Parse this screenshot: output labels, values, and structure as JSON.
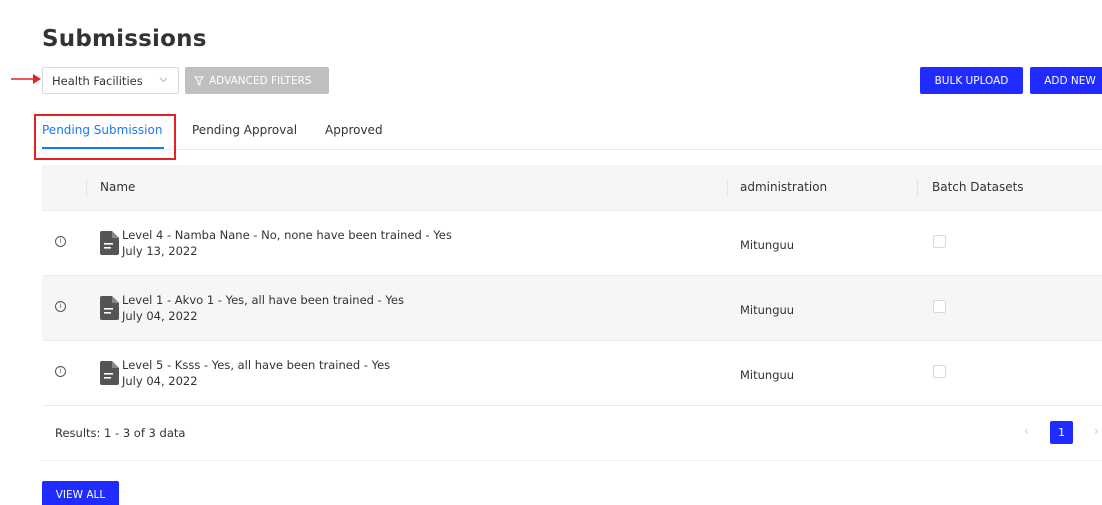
{
  "page": {
    "title": "Submissions"
  },
  "toolbar": {
    "form_select": {
      "value": "Health Facilities"
    },
    "advanced_filters_label": "ADVANCED FILTERS",
    "bulk_upload_label": "BULK UPLOAD",
    "add_new_label": "ADD NEW"
  },
  "tabs": [
    {
      "label": "Pending Submission",
      "active": true
    },
    {
      "label": "Pending Approval",
      "active": false
    },
    {
      "label": "Approved",
      "active": false
    }
  ],
  "table": {
    "columns": [
      "Name",
      "administration",
      "Batch Datasets"
    ],
    "rows": [
      {
        "name": "Level 4 - Namba Nane - No, none have been trained - Yes",
        "date": "July 13, 2022",
        "administration": "Mitunguu",
        "batch_checked": false
      },
      {
        "name": "Level 1 - Akvo 1 - Yes, all have been trained - Yes",
        "date": "July 04, 2022",
        "administration": "Mitunguu",
        "batch_checked": false
      },
      {
        "name": "Level 5 - Ksss - Yes, all have been trained - Yes",
        "date": "July 04, 2022",
        "administration": "Mitunguu",
        "batch_checked": false
      }
    ],
    "results_text": "Results: 1 - 3 of 3 data",
    "pagination": {
      "current_page": "1",
      "prev_icon": "chevron-left-icon",
      "next_icon": "chevron-right-icon"
    }
  },
  "view_all_label": "VIEW ALL",
  "colors": {
    "primary": "#1f2bff",
    "tab_active": "#1677ff",
    "highlight": "#e52222",
    "disabled": "#bfbfbf"
  }
}
